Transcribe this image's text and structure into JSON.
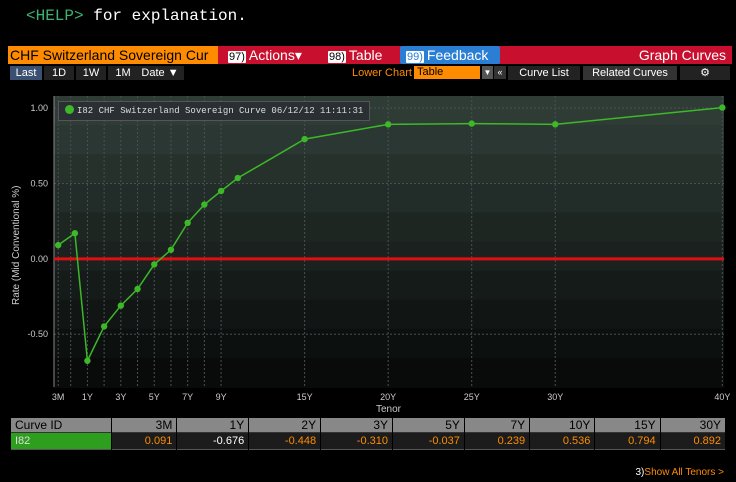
{
  "help": {
    "key": "<HELP>",
    "text": "for explanation."
  },
  "toolbar": {
    "title": "CHF Switzerland Sovereign Cur",
    "actions_num": "97)",
    "actions_label": "Actions",
    "table_num": "98)",
    "table_label": "Table",
    "feedback_num": "99)",
    "feedback_label": "Feedback",
    "graph_label": "Graph Curves"
  },
  "subbar": {
    "tabs": [
      "Last",
      "1D",
      "1W",
      "1M"
    ],
    "date_label": "Date ▼",
    "lower_chart_label": "Lower Chart",
    "lower_chart_value": "Table",
    "curve_list": "Curve List",
    "related_curves": "Related Curves",
    "gear": "⚙"
  },
  "legend": {
    "text": "I82 CHF Switzerland Sovereign Curve 06/12/12 11:11:31"
  },
  "colors": {
    "series": "#3cb829",
    "zero_line": "#e01010",
    "accent": "#ff8c00",
    "toolbar": "#c8102e",
    "feedback": "#2a7fd4"
  },
  "chart_data": {
    "type": "line",
    "ylabel": "Rate (Mid Conventional %)",
    "xlabel": "Tenor",
    "ylim": [
      -0.85,
      1.08
    ],
    "xlim": [
      0.0,
      40.1
    ],
    "y_ticks": [
      1.0,
      0.5,
      0.0,
      -0.5
    ],
    "y_tick_labels": [
      "1.00",
      "0.50",
      "0.00",
      "-0.50"
    ],
    "x_ticks": [
      0.25,
      1,
      2,
      3,
      4,
      5,
      6,
      7,
      8,
      9,
      10,
      15,
      20,
      25,
      30,
      40
    ],
    "x_tick_labels": [
      "3M",
      "",
      "1Y",
      "",
      "3Y",
      "",
      "5Y",
      "",
      "7Y",
      "",
      "9Y",
      "",
      "15Y",
      "20Y",
      "25Y",
      "30Y",
      "40Y"
    ],
    "x_label_map": [
      {
        "x": 0.25,
        "label": "3M"
      },
      {
        "x": 2,
        "label": "1Y"
      },
      {
        "x": 4,
        "label": "3Y"
      },
      {
        "x": 6,
        "label": "5Y"
      },
      {
        "x": 8,
        "label": "7Y"
      },
      {
        "x": 10,
        "label": "9Y"
      },
      {
        "x": 15,
        "label": "15Y"
      },
      {
        "x": 20,
        "label": "20Y"
      },
      {
        "x": 25,
        "label": "25Y"
      },
      {
        "x": 30,
        "label": "30Y"
      },
      {
        "x": 40,
        "label": "40Y"
      }
    ],
    "series": [
      {
        "name": "I82 CHF Switzerland Sovereign Curve 06/12/12 11:11:31",
        "points": [
          {
            "x": 0.25,
            "y": 0.091
          },
          {
            "x": 1.25,
            "y": 0.17
          },
          {
            "x": 2,
            "y": -0.676
          },
          {
            "x": 3,
            "y": -0.448
          },
          {
            "x": 4,
            "y": -0.31
          },
          {
            "x": 5,
            "y": -0.2
          },
          {
            "x": 6,
            "y": -0.037
          },
          {
            "x": 7,
            "y": 0.06
          },
          {
            "x": 8,
            "y": 0.239
          },
          {
            "x": 9,
            "y": 0.36
          },
          {
            "x": 10,
            "y": 0.45
          },
          {
            "x": 11,
            "y": 0.536
          },
          {
            "x": 15,
            "y": 0.794
          },
          {
            "x": 20,
            "y": 0.892
          },
          {
            "x": 25,
            "y": 0.897
          },
          {
            "x": 30,
            "y": 0.892
          },
          {
            "x": 40,
            "y": 1.003
          }
        ]
      }
    ],
    "zero_line": 0.0
  },
  "table": {
    "headers": [
      "Curve ID",
      "3M",
      "1Y",
      "2Y",
      "3Y",
      "5Y",
      "7Y",
      "10Y",
      "15Y",
      "30Y"
    ],
    "row": [
      "I82",
      "0.091",
      "-0.676",
      "-0.448",
      "-0.310",
      "-0.037",
      "0.239",
      "0.536",
      "0.794",
      "0.892"
    ]
  },
  "footer": {
    "num": "3)",
    "label": "Show All Tenors >"
  }
}
